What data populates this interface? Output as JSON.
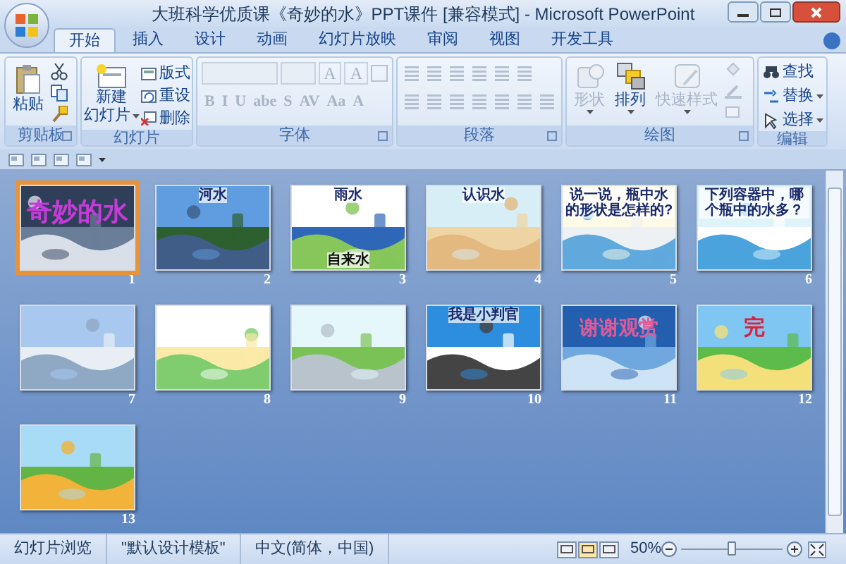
{
  "window": {
    "title": "大班科学优质课《奇妙的水》PPT课件 [兼容模式] - Microsoft PowerPoint"
  },
  "tabs": [
    {
      "label": "开始",
      "selected": true
    },
    {
      "label": "插入",
      "selected": false
    },
    {
      "label": "设计",
      "selected": false
    },
    {
      "label": "动画",
      "selected": false
    },
    {
      "label": "幻灯片放映",
      "selected": false
    },
    {
      "label": "审阅",
      "selected": false
    },
    {
      "label": "视图",
      "selected": false
    },
    {
      "label": "开发工具",
      "selected": false
    }
  ],
  "ribbon": {
    "clipboard": {
      "label": "剪贴板",
      "paste": "粘贴"
    },
    "slides": {
      "label": "幻灯片",
      "new_slide": [
        "新建",
        "幻灯片"
      ],
      "items": [
        "版式",
        "重设",
        "删除"
      ]
    },
    "font": {
      "label": "字体",
      "disabled": true,
      "row_1": [
        "A",
        "A"
      ],
      "row_2": [
        "B",
        "I",
        "U",
        "abe",
        "S",
        "AV",
        "Aa",
        "A"
      ]
    },
    "paragraph": {
      "label": "段落",
      "disabled": true
    },
    "drawing": {
      "label": "绘图",
      "items": [
        {
          "label": "形状",
          "disabled": true
        },
        {
          "label": "排列",
          "disabled": false
        },
        {
          "label": "快速样式",
          "disabled": true
        }
      ]
    },
    "editing": {
      "label": "编辑",
      "items": [
        {
          "label": "查找",
          "dropdown": false
        },
        {
          "label": "替换",
          "dropdown": true
        },
        {
          "label": "选择",
          "dropdown": true
        }
      ]
    }
  },
  "slides": [
    {
      "number": "1",
      "selected": true,
      "kind": "cover",
      "texts": [
        "奇妙的水"
      ]
    },
    {
      "number": "2",
      "selected": false,
      "kind": "content",
      "texts": [
        "河水"
      ]
    },
    {
      "number": "3",
      "selected": false,
      "kind": "content",
      "texts": [
        "雨水",
        "自来水"
      ]
    },
    {
      "number": "4",
      "selected": false,
      "kind": "content",
      "texts": [
        "认识水"
      ]
    },
    {
      "number": "5",
      "selected": false,
      "kind": "content",
      "texts": [
        "说一说，瓶中水的形状是怎样的?"
      ]
    },
    {
      "number": "6",
      "selected": false,
      "kind": "content",
      "texts": [
        "下列容器中，哪个瓶中的水多？"
      ]
    },
    {
      "number": "7",
      "selected": false,
      "kind": "content"
    },
    {
      "number": "8",
      "selected": false,
      "kind": "content"
    },
    {
      "number": "9",
      "selected": false,
      "kind": "content"
    },
    {
      "number": "10",
      "selected": false,
      "kind": "content",
      "texts": [
        "我是小判官"
      ]
    },
    {
      "number": "11",
      "selected": false,
      "kind": "cover",
      "texts": [
        "谢谢观赏"
      ]
    },
    {
      "number": "12",
      "selected": false,
      "kind": "cover",
      "texts": [
        "完"
      ]
    },
    {
      "number": "13",
      "selected": false,
      "kind": "content"
    }
  ],
  "status_bar": {
    "items": [
      "幻灯片浏览",
      "\"默认设计模板\"",
      "中文(简体，中国)"
    ],
    "zoom": "50%",
    "zoom_slider": {
      "level": 0.5
    }
  }
}
